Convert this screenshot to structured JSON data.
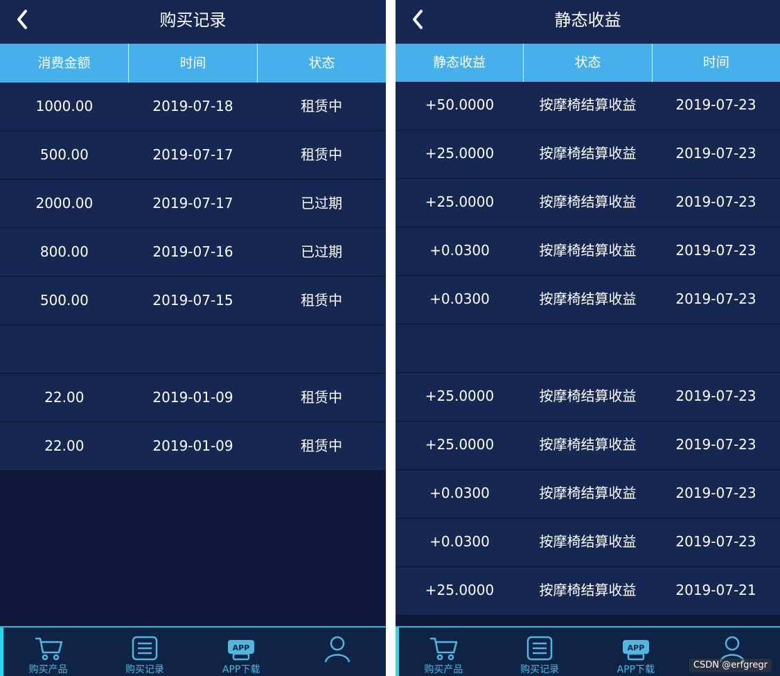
{
  "left": {
    "title": "购买记录",
    "columns": [
      "消费金额",
      "时间",
      "状态"
    ],
    "rows": [
      [
        "1000.00",
        "2019-07-18",
        "租赁中"
      ],
      [
        "500.00",
        "2019-07-17",
        "租赁中"
      ],
      [
        "2000.00",
        "2019-07-17",
        "已过期"
      ],
      [
        "800.00",
        "2019-07-16",
        "已过期"
      ],
      [
        "500.00",
        "2019-07-15",
        "租赁中"
      ],
      [
        "",
        "",
        ""
      ],
      [
        "22.00",
        "2019-01-09",
        "租赁中"
      ],
      [
        "22.00",
        "2019-01-09",
        "租赁中"
      ]
    ]
  },
  "right": {
    "title": "静态收益",
    "columns": [
      "静态收益",
      "状态",
      "时间"
    ],
    "rows": [
      [
        "+50.0000",
        "按摩椅结算收益",
        "2019-07-23"
      ],
      [
        "+25.0000",
        "按摩椅结算收益",
        "2019-07-23"
      ],
      [
        "+25.0000",
        "按摩椅结算收益",
        "2019-07-23"
      ],
      [
        "+0.0300",
        "按摩椅结算收益",
        "2019-07-23"
      ],
      [
        "+0.0300",
        "按摩椅结算收益",
        "2019-07-23"
      ],
      [
        "",
        "",
        ""
      ],
      [
        "+25.0000",
        "按摩椅结算收益",
        "2019-07-23"
      ],
      [
        "+25.0000",
        "按摩椅结算收益",
        "2019-07-23"
      ],
      [
        "+0.0300",
        "按摩椅结算收益",
        "2019-07-23"
      ],
      [
        "+0.0300",
        "按摩椅结算收益",
        "2019-07-23"
      ],
      [
        "+25.0000",
        "按摩椅结算收益",
        "2019-07-21"
      ]
    ]
  },
  "nav": [
    {
      "label": "购买产品",
      "icon": "cart-icon"
    },
    {
      "label": "购买记录",
      "icon": "list-icon"
    },
    {
      "label": "APP下载",
      "icon": "app-download-icon",
      "icon_text": "APP"
    },
    {
      "label": "",
      "icon": "user-icon"
    }
  ],
  "watermark": "CSDN @erfgregr",
  "colors": {
    "background": "#0e1838",
    "row": "#162752",
    "header": "#45b0ea",
    "accent": "#27d9f0",
    "nav_label": "#4fb7e2"
  }
}
